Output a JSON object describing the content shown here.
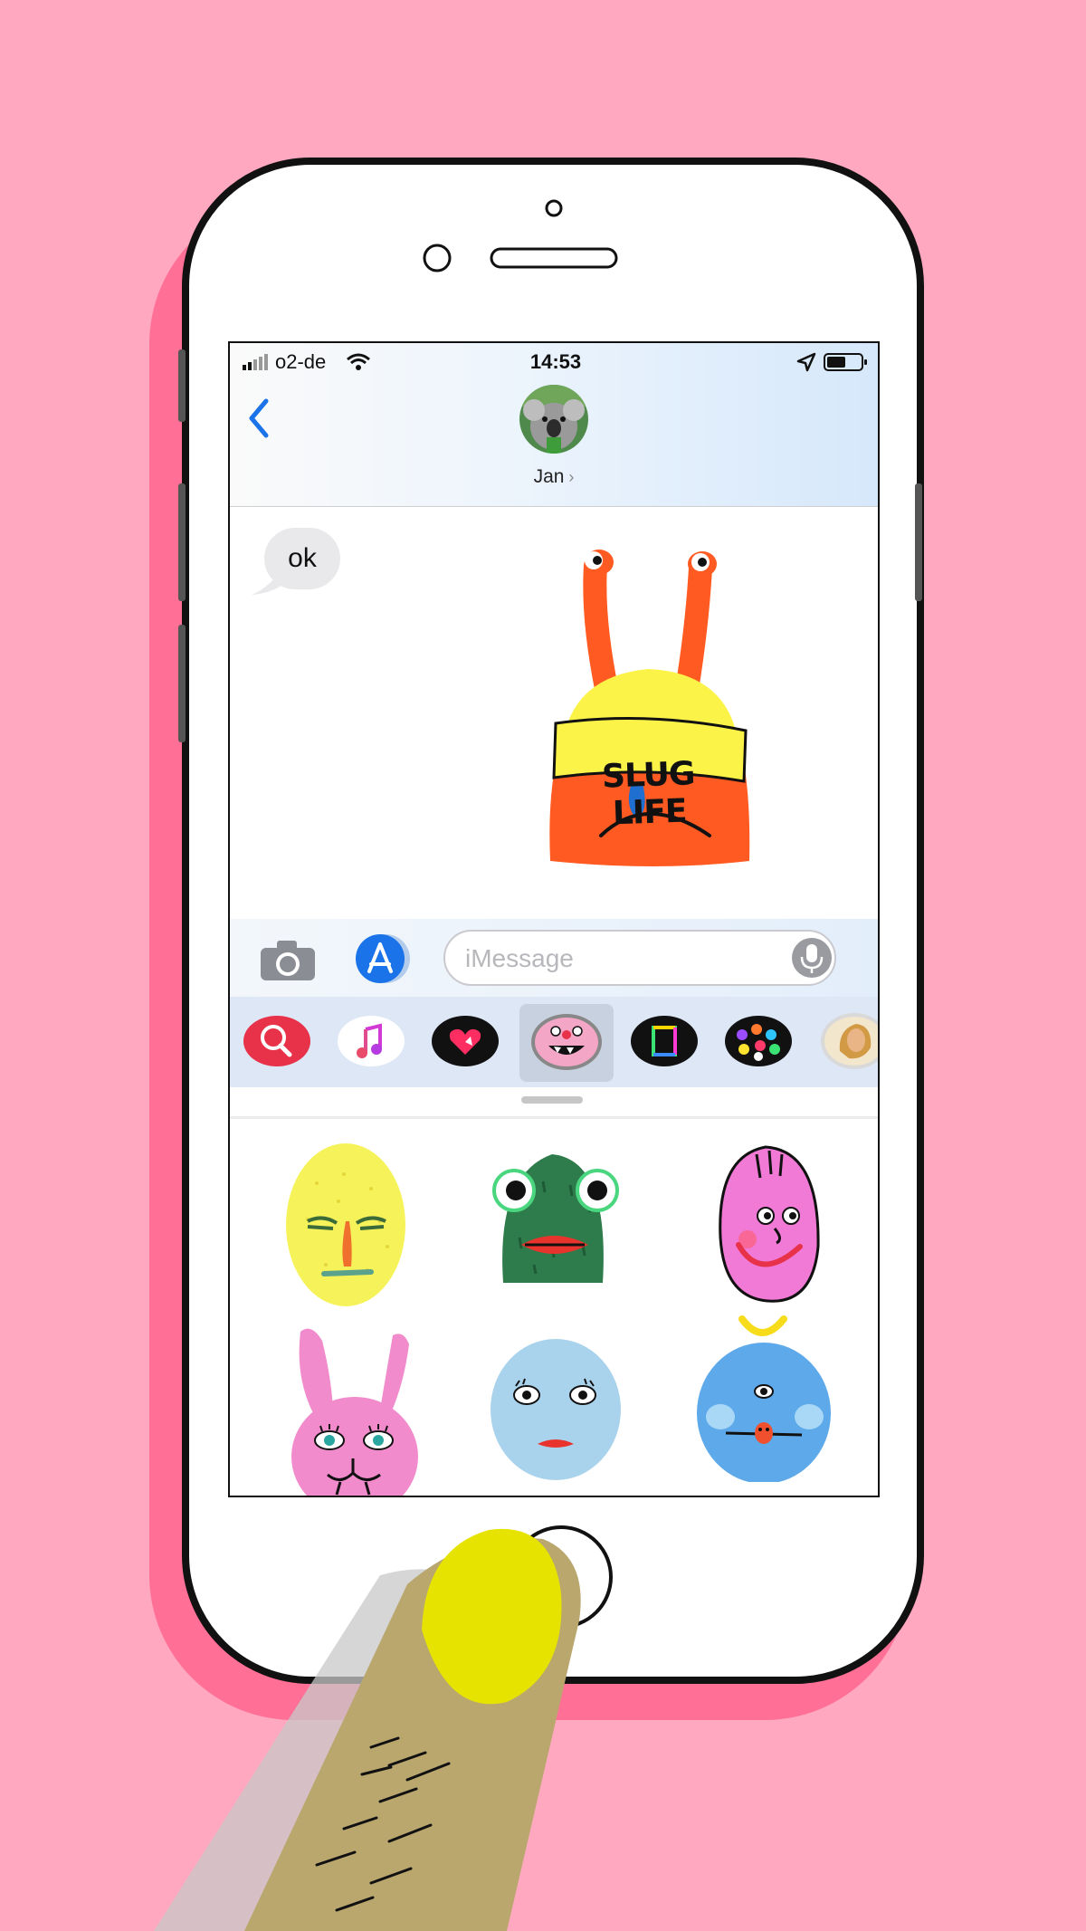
{
  "status_bar": {
    "carrier": "o2-de",
    "time": "14:53"
  },
  "conversation": {
    "contact_name": "Jan",
    "messages": [
      {
        "type": "text",
        "from": "contact",
        "text": "ok"
      },
      {
        "type": "sticker",
        "from": "me",
        "sticker_text": "SLUG LIFE"
      }
    ]
  },
  "composer": {
    "placeholder": "iMessage"
  },
  "app_drawer": {
    "apps": [
      {
        "icon": "images-search-icon",
        "color": "#e8324a"
      },
      {
        "icon": "music-icon",
        "color": "#ffffff"
      },
      {
        "icon": "digital-touch-heart-icon",
        "color": "#111111"
      },
      {
        "icon": "monster-sticker-app-icon",
        "color": "#f4a6c6",
        "selected": true
      },
      {
        "icon": "gif-frame-icon",
        "color": "#111111"
      },
      {
        "icon": "emoji-pack-icon",
        "color": "#111111"
      },
      {
        "icon": "art-portrait-icon",
        "color": "#f2e6cc"
      }
    ],
    "stickers": [
      {
        "icon": "yellow-egg-face-sticker",
        "color": "#f6f35a"
      },
      {
        "icon": "green-frog-face-sticker",
        "color": "#2e7b4c"
      },
      {
        "icon": "pink-smiling-face-sticker",
        "color": "#f07ad6"
      },
      {
        "icon": "pink-bunny-face-sticker",
        "color": "#f28bcc"
      },
      {
        "icon": "light-blue-face-sticker",
        "color": "#a9d3ec"
      },
      {
        "icon": "blue-cyclops-face-sticker",
        "color": "#5ea9ea"
      }
    ]
  },
  "colors": {
    "background": "#ffa8c0",
    "phone_shadow": "#ff6f96",
    "accent_blue": "#1a73e8",
    "nail_yellow": "#e7e300",
    "finger": "#b9a76e"
  }
}
